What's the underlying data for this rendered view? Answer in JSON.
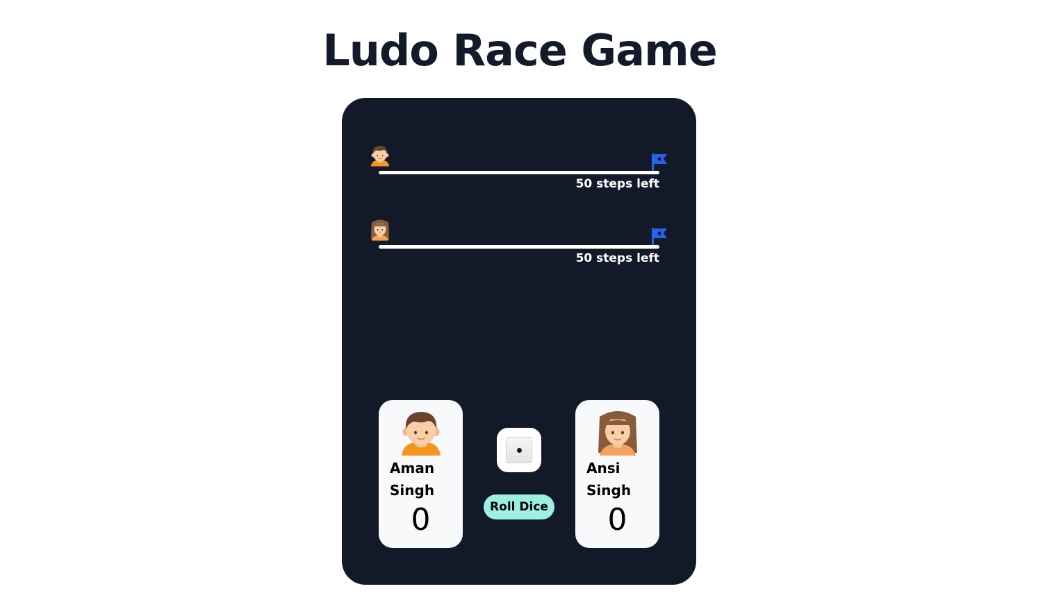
{
  "title": "Ludo Race Game",
  "tracks": [
    {
      "player": "Aman Singh",
      "steps_text": "50 steps left",
      "token_icon": "boy-avatar-icon",
      "finish_icon": "finish-flag-icon",
      "progress": 0
    },
    {
      "player": "Ansi Singh",
      "steps_text": "50 steps left",
      "token_icon": "girl-avatar-icon",
      "finish_icon": "finish-flag-icon",
      "progress": 0
    }
  ],
  "players": [
    {
      "first_name": "Aman",
      "last_name": "Singh",
      "score": "0",
      "avatar_icon": "boy-avatar-icon"
    },
    {
      "first_name": "Ansi",
      "last_name": "Singh",
      "score": "0",
      "avatar_icon": "girl-avatar-icon"
    }
  ],
  "dice": {
    "value": 1,
    "icon": "dice-icon"
  },
  "roll_button_label": "Roll Dice",
  "colors": {
    "board": "#121928",
    "title": "#131a29",
    "card": "#f7f9fb",
    "button": "#9bf0e1",
    "flag": "#2563eb",
    "track": "#ffffff"
  }
}
